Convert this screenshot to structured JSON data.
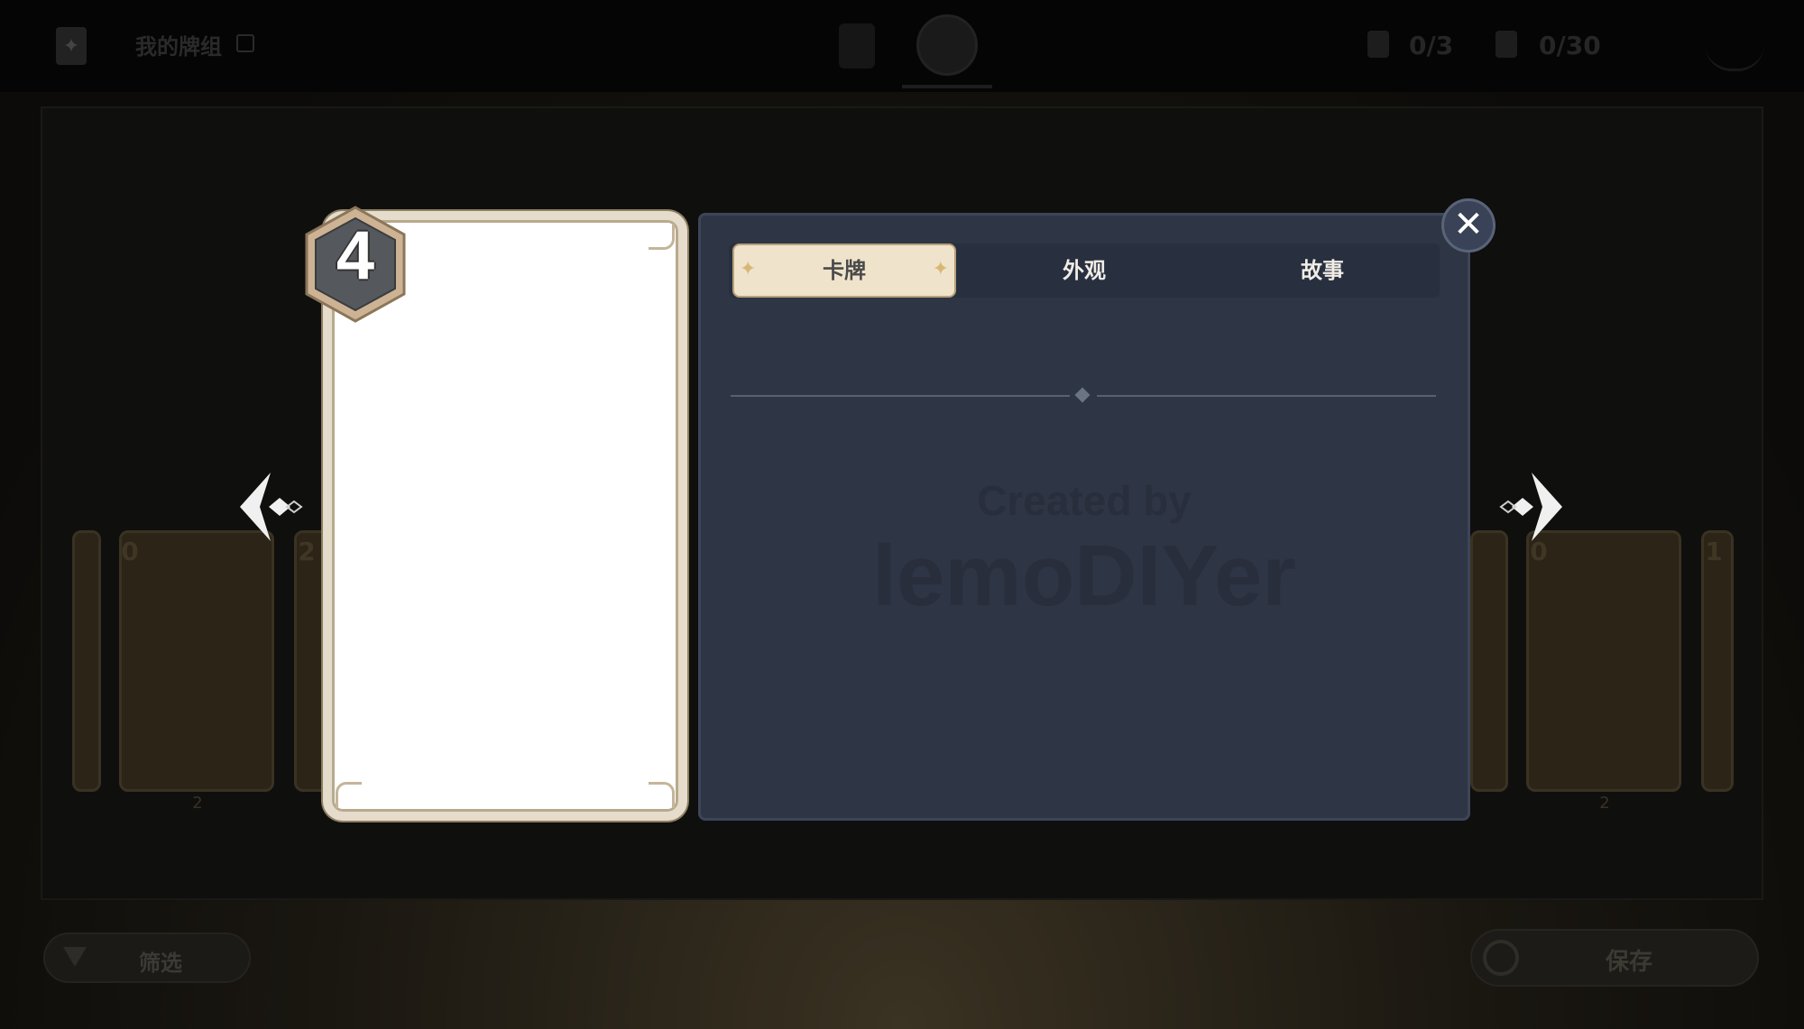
{
  "topbar": {
    "deck_name": "我的牌组",
    "character_count": "0/3",
    "action_count": "0/30"
  },
  "background_cards": {
    "left": [
      {
        "cost": "0",
        "sub": "2"
      },
      {
        "cost": "2",
        "sub": ""
      }
    ],
    "right": [
      {
        "cost": "0",
        "sub": "2"
      },
      {
        "cost": "1",
        "sub": ""
      }
    ]
  },
  "card": {
    "cost": "4"
  },
  "detail_panel": {
    "tabs": [
      {
        "label": "卡牌",
        "active": true
      },
      {
        "label": "外观",
        "active": false
      },
      {
        "label": "故事",
        "active": false
      }
    ],
    "watermark_line1": "Created by",
    "watermark_line2": "lemoDIYer"
  },
  "bottom": {
    "filter_label": "筛选",
    "save_label": "保存"
  },
  "icons": {
    "close": "close-icon",
    "prev": "prev-arrow-icon",
    "next": "next-arrow-icon"
  },
  "colors": {
    "panel_bg": "#2e3544",
    "tab_active_bg": "#efe3cb",
    "card_frame": "#e6dccb"
  }
}
